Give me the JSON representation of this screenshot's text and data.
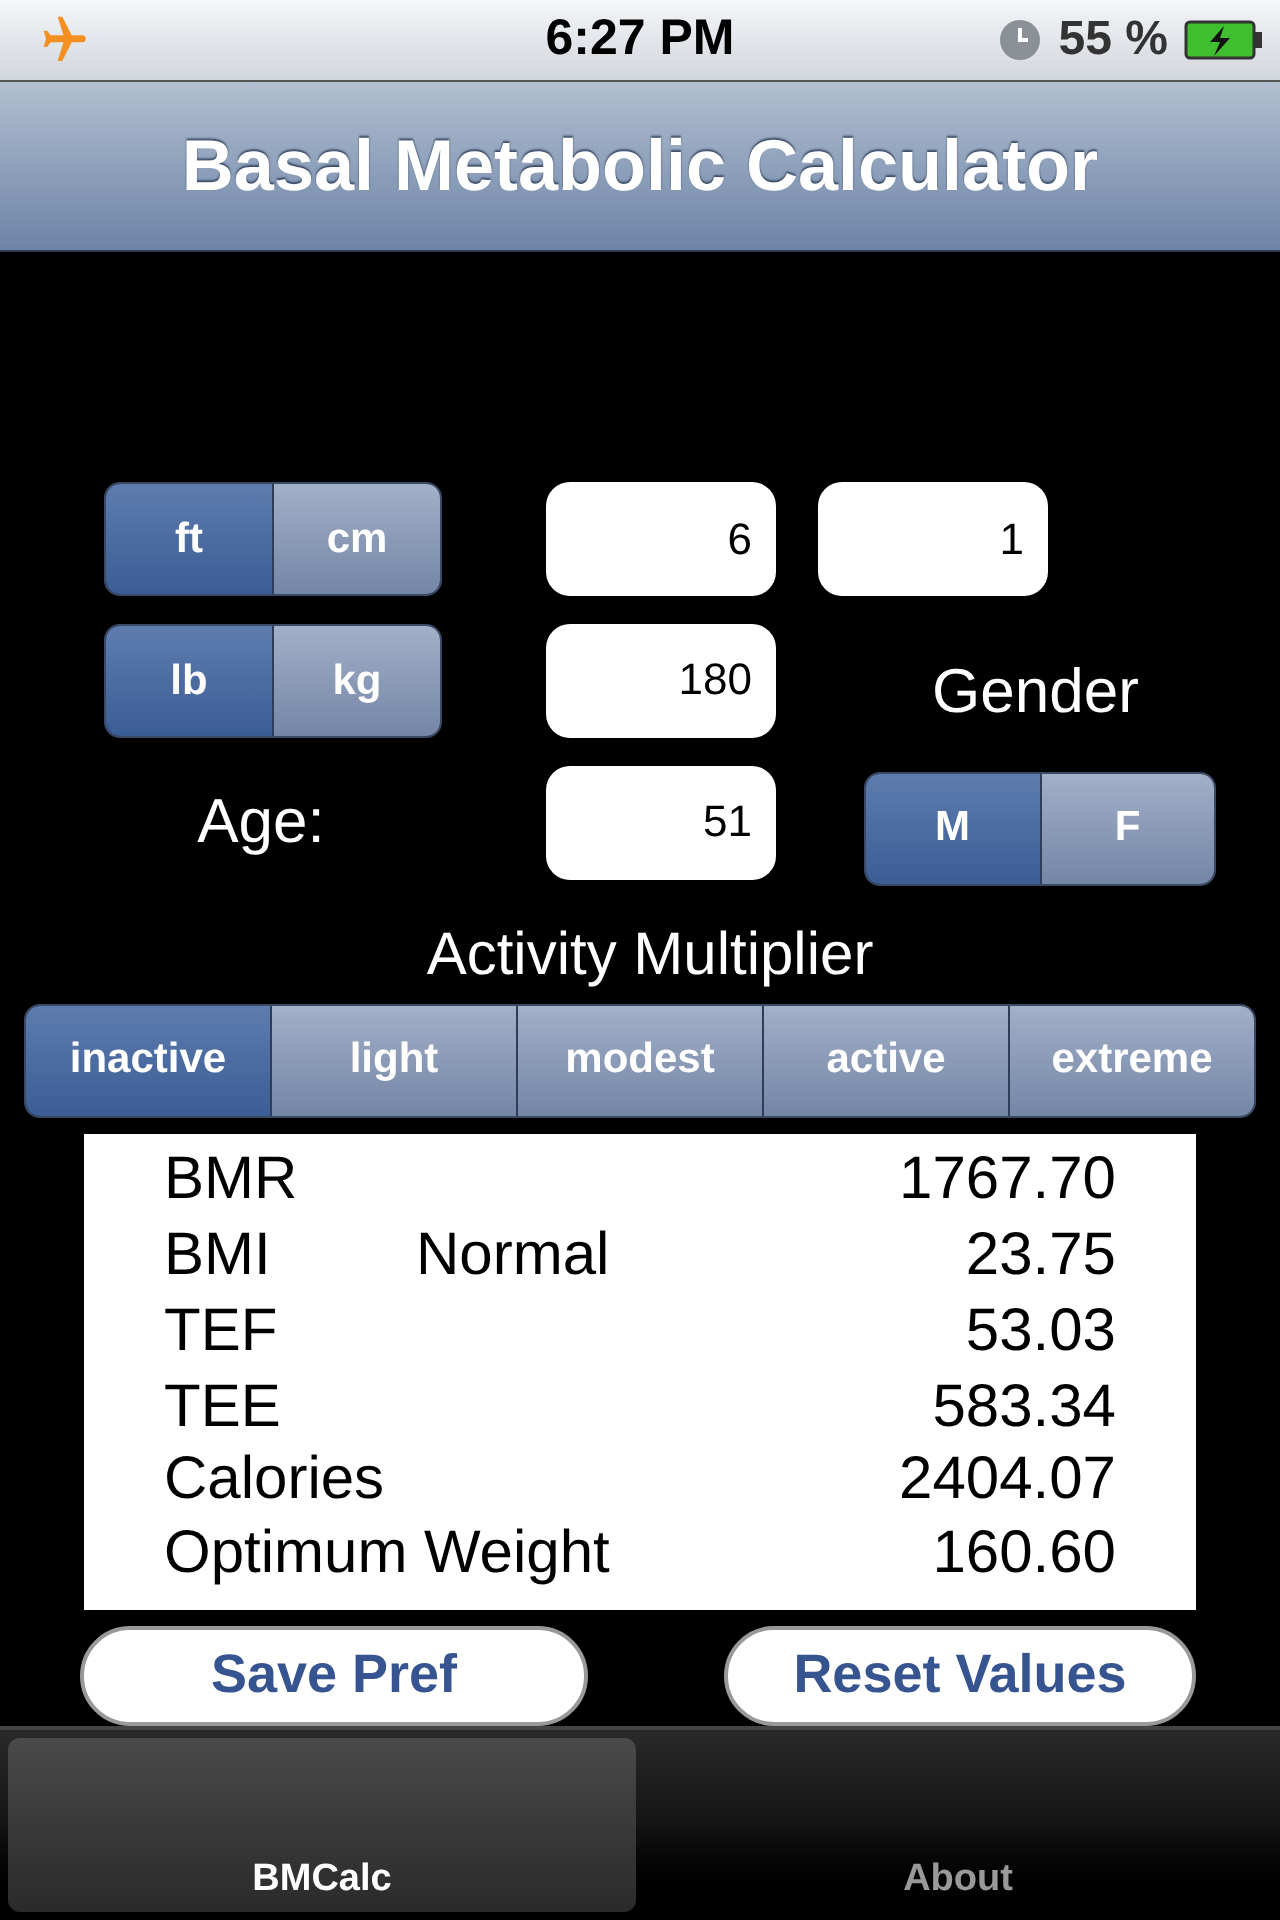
{
  "status_bar": {
    "time": "6:27 PM",
    "battery": "55 %"
  },
  "title": "Basal Metabolic Calculator",
  "height_units": [
    {
      "label": "ft",
      "selected": true
    },
    {
      "label": "cm",
      "selected": false
    }
  ],
  "height_fields": [
    {
      "value": "6"
    },
    {
      "value": "1"
    }
  ],
  "weight_units": [
    {
      "label": "lb",
      "selected": true
    },
    {
      "label": "kg",
      "selected": false
    }
  ],
  "weight_field": {
    "value": "180"
  },
  "gender_label": "Gender",
  "age_label": "Age:",
  "age_field": {
    "value": "51"
  },
  "gender_options": [
    {
      "label": "M",
      "selected": true
    },
    {
      "label": "F",
      "selected": false
    }
  ],
  "activity_label": "Activity Multiplier",
  "activity_options": [
    {
      "label": "inactive",
      "selected": true
    },
    {
      "label": "light",
      "selected": false
    },
    {
      "label": "modest",
      "selected": false
    },
    {
      "label": "active",
      "selected": false
    },
    {
      "label": "extreme",
      "selected": false
    }
  ],
  "results": [
    {
      "label": "BMR",
      "value": "1767.70"
    },
    {
      "label": "BMI",
      "status": "Normal",
      "value": "23.75"
    },
    {
      "label": "TEF",
      "value": "53.03"
    },
    {
      "label": "TEE",
      "value": "583.34"
    },
    {
      "label": "Calories",
      "value": "2404.07"
    },
    {
      "label": "Optimum Weight",
      "value": "160.60"
    }
  ],
  "buttons": [
    "Save Pref",
    "Reset Values"
  ],
  "tabs": [
    {
      "label": "BMCalc",
      "selected": true
    },
    {
      "label": "About",
      "selected": false
    }
  ]
}
